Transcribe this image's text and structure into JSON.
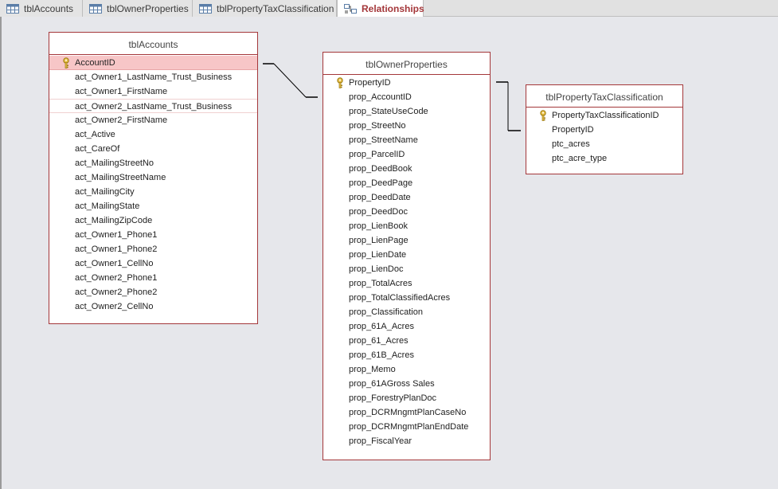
{
  "tabs": [
    {
      "label": "tblAccounts",
      "active": false,
      "icon": "table-icon"
    },
    {
      "label": "tblOwnerProperties",
      "active": false,
      "icon": "table-icon"
    },
    {
      "label": "tblPropertyTaxClassification",
      "active": false,
      "icon": "table-icon"
    },
    {
      "label": "Relationships",
      "active": true,
      "icon": "relationships-icon"
    }
  ],
  "tables": {
    "accounts": {
      "title": "tblAccounts",
      "fields": [
        {
          "name": "AccountID",
          "key": true
        },
        {
          "name": "act_Owner1_LastName_Trust_Business"
        },
        {
          "name": "act_Owner1_FirstName"
        },
        {
          "name": "act_Owner2_LastName_Trust_Business"
        },
        {
          "name": "act_Owner2_FirstName"
        },
        {
          "name": "act_Active"
        },
        {
          "name": "act_CareOf"
        },
        {
          "name": "act_MailingStreetNo"
        },
        {
          "name": "act_MailingStreetName"
        },
        {
          "name": "act_MailingCity"
        },
        {
          "name": "act_MailingState"
        },
        {
          "name": "act_MailingZipCode"
        },
        {
          "name": "act_Owner1_Phone1"
        },
        {
          "name": "act_Owner1_Phone2"
        },
        {
          "name": "act_Owner1_CellNo"
        },
        {
          "name": "act_Owner2_Phone1"
        },
        {
          "name": "act_Owner2_Phone2"
        },
        {
          "name": "act_Owner2_CellNo"
        }
      ]
    },
    "owner_properties": {
      "title": "tblOwnerProperties",
      "fields": [
        {
          "name": "PropertyID",
          "key": true
        },
        {
          "name": "prop_AccountID"
        },
        {
          "name": "prop_StateUseCode"
        },
        {
          "name": "prop_StreetNo"
        },
        {
          "name": "prop_StreetName"
        },
        {
          "name": "prop_ParcelID"
        },
        {
          "name": "prop_DeedBook"
        },
        {
          "name": "prop_DeedPage"
        },
        {
          "name": "prop_DeedDate"
        },
        {
          "name": "prop_DeedDoc"
        },
        {
          "name": "prop_LienBook"
        },
        {
          "name": "prop_LienPage"
        },
        {
          "name": "prop_LienDate"
        },
        {
          "name": "prop_LienDoc"
        },
        {
          "name": "prop_TotalAcres"
        },
        {
          "name": "prop_TotalClassifiedAcres"
        },
        {
          "name": "prop_Classification"
        },
        {
          "name": "prop_61A_Acres"
        },
        {
          "name": "prop_61_Acres"
        },
        {
          "name": "prop_61B_Acres"
        },
        {
          "name": "prop_Memo"
        },
        {
          "name": "prop_61AGross Sales"
        },
        {
          "name": "prop_ForestryPlanDoc"
        },
        {
          "name": "prop_DCRMngmtPlanCaseNo"
        },
        {
          "name": "prop_DCRMngmtPlanEndDate"
        },
        {
          "name": "prop_FiscalYear"
        }
      ]
    },
    "tax_classification": {
      "title": "tblPropertyTaxClassification",
      "fields": [
        {
          "name": "PropertyTaxClassificationID",
          "key": true
        },
        {
          "name": "PropertyID"
        },
        {
          "name": "ptc_acres"
        },
        {
          "name": "ptc_acre_type"
        }
      ]
    }
  },
  "colors": {
    "table_border": "#a4373a",
    "selected_row": "#f7c6c7",
    "active_tab_text": "#a4373a",
    "canvas": "#e6e7eb",
    "key_icon": "#d4a017"
  }
}
